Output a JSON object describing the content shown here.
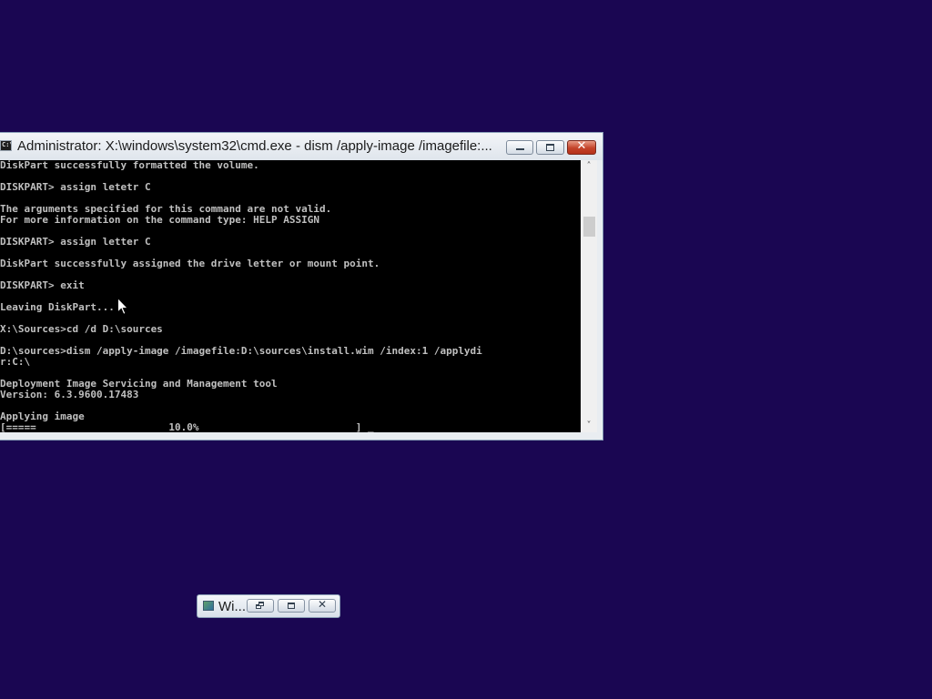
{
  "cmd_window": {
    "title": "Administrator: X:\\windows\\system32\\cmd.exe - dism  /apply-image /imagefile:...",
    "icon": "cmd-icon",
    "icon_text": "C:\\",
    "buttons": {
      "minimize": "minimize-icon",
      "maximize": "maximize-icon",
      "close": "close-icon",
      "close_glyph": "✕"
    },
    "console_lines": [
      "DiskPart successfully formatted the volume.",
      "",
      "DISKPART> assign letetr C",
      "",
      "The arguments specified for this command are not valid.",
      "For more information on the command type: HELP ASSIGN",
      "",
      "DISKPART> assign letter C",
      "",
      "DiskPart successfully assigned the drive letter or mount point.",
      "",
      "DISKPART> exit",
      "",
      "Leaving DiskPart...",
      "",
      "X:\\Sources>cd /d D:\\sources",
      "",
      "D:\\sources>dism /apply-image /imagefile:D:\\sources\\install.wim /index:1 /applydi",
      "r:C:\\",
      "",
      "Deployment Image Servicing and Management tool",
      "Version: 6.3.9600.17483",
      "",
      "Applying image",
      "[=====                      10.0%                          ] _"
    ],
    "progress": {
      "percent_value": 10.0
    },
    "scrollbar": {
      "up_arrow": "˄",
      "down_arrow": "˅"
    }
  },
  "minimized_window": {
    "title": "Wi...",
    "icon": "windows-setup-icon",
    "close_glyph": "✕"
  },
  "colors": {
    "desktop_background": "#1a0652",
    "console_background": "#000000",
    "console_text": "#c0c0c0",
    "close_button": "#c3432a"
  }
}
